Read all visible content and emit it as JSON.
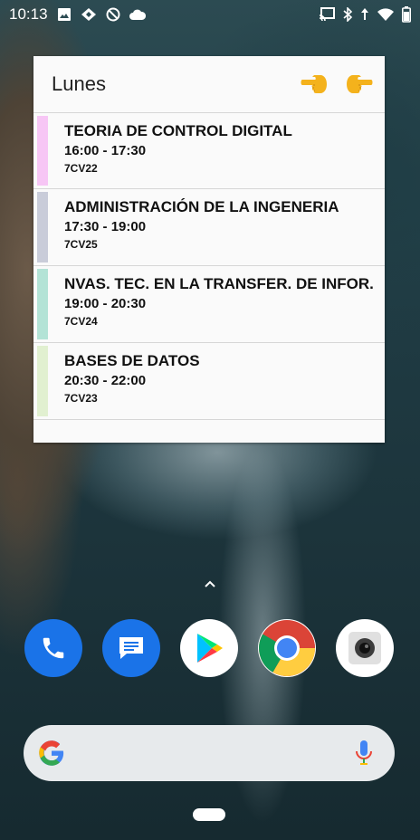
{
  "status_bar": {
    "time": "10:13",
    "left_icons": [
      "image-notification-icon",
      "diamond-notification-icon",
      "blocked-notification-icon",
      "cloud-icon"
    ],
    "right_icons": [
      "cast-icon",
      "bluetooth-icon",
      "data-arrows-icon",
      "wifi-icon",
      "battery-icon"
    ]
  },
  "widget": {
    "title": "Lunes",
    "prev_icon": "hand-pointing-left-icon",
    "next_icon": "hand-pointing-right-icon",
    "classes": [
      {
        "name": "TEORIA DE CONTROL DIGITAL",
        "time": "16:00 - 17:30",
        "group": "7CV22",
        "color": "#f7c6f5"
      },
      {
        "name": "ADMINISTRACIÓN DE LA INGENERIA",
        "time": "17:30 - 19:00",
        "group": "7CV25",
        "color": "#c9ccd9"
      },
      {
        "name": "NVAS. TEC. EN LA TRANSFER. DE INFOR.",
        "time": "19:00 - 20:30",
        "group": "7CV24",
        "color": "#b3e3d6"
      },
      {
        "name": "BASES DE DATOS",
        "time": "20:30 - 22:00",
        "group": "7CV23",
        "color": "#e1f0d0"
      }
    ]
  },
  "dock": {
    "apps": [
      {
        "name": "Phone",
        "icon": "phone-icon"
      },
      {
        "name": "Messages",
        "icon": "messages-icon"
      },
      {
        "name": "Play Store",
        "icon": "play-store-icon"
      },
      {
        "name": "Chrome",
        "icon": "chrome-icon"
      },
      {
        "name": "Camera",
        "icon": "camera-icon"
      }
    ]
  },
  "search_bar": {
    "logo": "google-g-icon",
    "mic": "mic-icon"
  },
  "colors": {
    "widget_bg": "#fafafa",
    "phone_blue": "#1a73e8",
    "search_bg": "#e7eaec"
  }
}
